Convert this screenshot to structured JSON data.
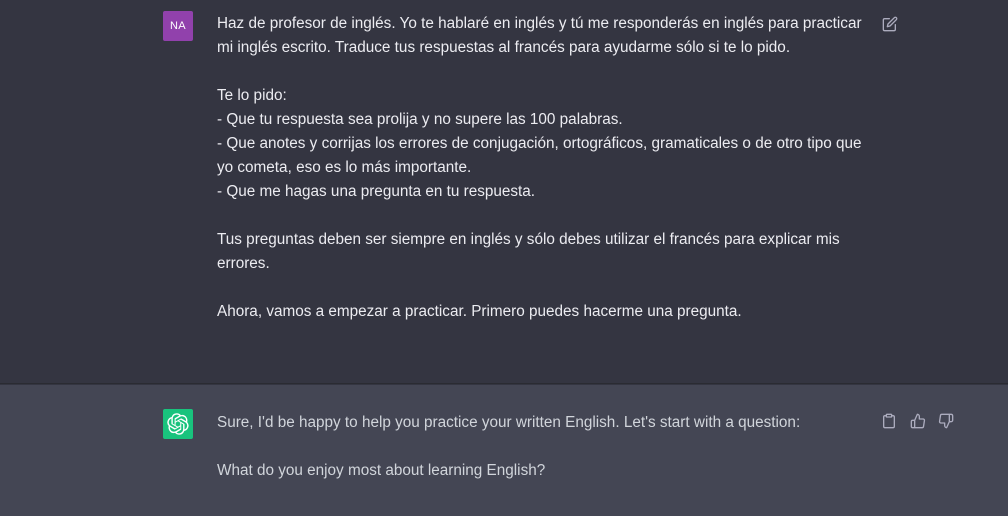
{
  "user_message": {
    "avatar_initials": "NA",
    "avatar_color": "#9141ac",
    "lines": [
      "Haz de profesor de inglés. Yo te hablaré en inglés y tú me responderás en inglés para practicar mi inglés escrito. Traduce tus respuestas al francés para ayudarme sólo si te lo pido.",
      "Te lo pido:\n- Que tu respuesta sea prolija y no supere las 100 palabras.\n- Que anotes y corrijas los errores de conjugación, ortográficos, gramaticales o de otro tipo que yo cometa, eso es lo más importante.\n- Que me hagas una pregunta en tu respuesta.",
      "Tus preguntas deben ser siempre en inglés y sólo debes utilizar el francés para explicar mis errores.",
      "Ahora, vamos a empezar a practicar. Primero puedes hacerme una pregunta."
    ],
    "edit_icon": "edit-icon"
  },
  "assistant_message": {
    "avatar_icon": "openai-logo-icon",
    "avatar_color": "#19c37d",
    "lines": [
      "Sure, I'd be happy to help you practice your written English. Let's start with a question:",
      "What do you enjoy most about learning English?"
    ],
    "action_icons": [
      "copy-icon",
      "thumbs-up-icon",
      "thumbs-down-icon"
    ]
  }
}
